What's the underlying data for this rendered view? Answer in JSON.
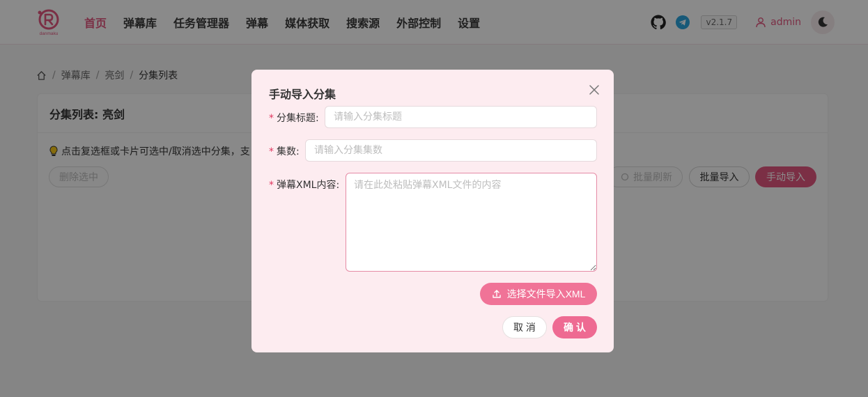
{
  "header": {
    "logo_text": "danmaku",
    "nav": [
      {
        "label": "首页",
        "active": true
      },
      {
        "label": "弹幕库",
        "active": false
      },
      {
        "label": "任务管理器",
        "active": false
      },
      {
        "label": "弹幕",
        "active": false
      },
      {
        "label": "媒体获取",
        "active": false
      },
      {
        "label": "搜索源",
        "active": false
      },
      {
        "label": "外部控制",
        "active": false
      },
      {
        "label": "设置",
        "active": false
      }
    ],
    "version": "v2.1.7",
    "user": "admin"
  },
  "breadcrumb": [
    "弹幕库",
    "亮剑",
    "分集列表"
  ],
  "card": {
    "title": "分集列表: 亮剑",
    "tip": "点击复选框或卡片可选中/取消选中分集，支",
    "delete_selected": "删除选中",
    "batch_refresh": "批量刷新",
    "batch_import": "批量导入",
    "manual_import": "手动导入"
  },
  "modal": {
    "title": "手动导入分集",
    "fields": {
      "title_label": "分集标题",
      "title_placeholder": "请输入分集标题",
      "episode_label": "集数",
      "episode_placeholder": "请输入分集集数",
      "xml_label": "弹幕XML内容",
      "xml_placeholder": "请在此处粘贴弹幕XML文件的内容"
    },
    "upload_label": "选择文件导入XML",
    "cancel_label": "取 消",
    "confirm_label": "确 认"
  },
  "colors": {
    "accent": "#e0577f",
    "modal_bg": "#fdecf0",
    "upload_bg": "#f07397"
  }
}
